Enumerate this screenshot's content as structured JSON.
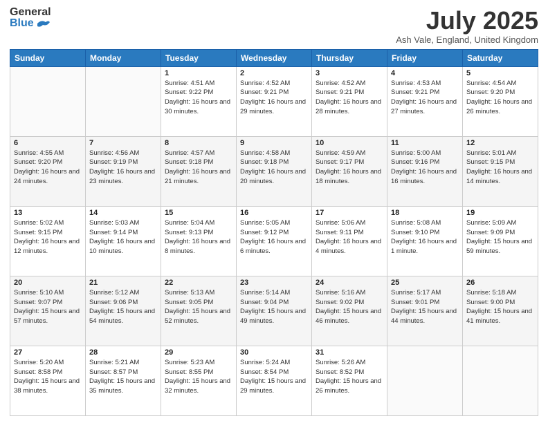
{
  "header": {
    "logo_general": "General",
    "logo_blue": "Blue",
    "month_year": "July 2025",
    "location": "Ash Vale, England, United Kingdom"
  },
  "weekdays": [
    "Sunday",
    "Monday",
    "Tuesday",
    "Wednesday",
    "Thursday",
    "Friday",
    "Saturday"
  ],
  "weeks": [
    [
      {
        "day": "",
        "info": ""
      },
      {
        "day": "",
        "info": ""
      },
      {
        "day": "1",
        "info": "Sunrise: 4:51 AM\nSunset: 9:22 PM\nDaylight: 16 hours and 30 minutes."
      },
      {
        "day": "2",
        "info": "Sunrise: 4:52 AM\nSunset: 9:21 PM\nDaylight: 16 hours and 29 minutes."
      },
      {
        "day": "3",
        "info": "Sunrise: 4:52 AM\nSunset: 9:21 PM\nDaylight: 16 hours and 28 minutes."
      },
      {
        "day": "4",
        "info": "Sunrise: 4:53 AM\nSunset: 9:21 PM\nDaylight: 16 hours and 27 minutes."
      },
      {
        "day": "5",
        "info": "Sunrise: 4:54 AM\nSunset: 9:20 PM\nDaylight: 16 hours and 26 minutes."
      }
    ],
    [
      {
        "day": "6",
        "info": "Sunrise: 4:55 AM\nSunset: 9:20 PM\nDaylight: 16 hours and 24 minutes."
      },
      {
        "day": "7",
        "info": "Sunrise: 4:56 AM\nSunset: 9:19 PM\nDaylight: 16 hours and 23 minutes."
      },
      {
        "day": "8",
        "info": "Sunrise: 4:57 AM\nSunset: 9:18 PM\nDaylight: 16 hours and 21 minutes."
      },
      {
        "day": "9",
        "info": "Sunrise: 4:58 AM\nSunset: 9:18 PM\nDaylight: 16 hours and 20 minutes."
      },
      {
        "day": "10",
        "info": "Sunrise: 4:59 AM\nSunset: 9:17 PM\nDaylight: 16 hours and 18 minutes."
      },
      {
        "day": "11",
        "info": "Sunrise: 5:00 AM\nSunset: 9:16 PM\nDaylight: 16 hours and 16 minutes."
      },
      {
        "day": "12",
        "info": "Sunrise: 5:01 AM\nSunset: 9:15 PM\nDaylight: 16 hours and 14 minutes."
      }
    ],
    [
      {
        "day": "13",
        "info": "Sunrise: 5:02 AM\nSunset: 9:15 PM\nDaylight: 16 hours and 12 minutes."
      },
      {
        "day": "14",
        "info": "Sunrise: 5:03 AM\nSunset: 9:14 PM\nDaylight: 16 hours and 10 minutes."
      },
      {
        "day": "15",
        "info": "Sunrise: 5:04 AM\nSunset: 9:13 PM\nDaylight: 16 hours and 8 minutes."
      },
      {
        "day": "16",
        "info": "Sunrise: 5:05 AM\nSunset: 9:12 PM\nDaylight: 16 hours and 6 minutes."
      },
      {
        "day": "17",
        "info": "Sunrise: 5:06 AM\nSunset: 9:11 PM\nDaylight: 16 hours and 4 minutes."
      },
      {
        "day": "18",
        "info": "Sunrise: 5:08 AM\nSunset: 9:10 PM\nDaylight: 16 hours and 1 minute."
      },
      {
        "day": "19",
        "info": "Sunrise: 5:09 AM\nSunset: 9:09 PM\nDaylight: 15 hours and 59 minutes."
      }
    ],
    [
      {
        "day": "20",
        "info": "Sunrise: 5:10 AM\nSunset: 9:07 PM\nDaylight: 15 hours and 57 minutes."
      },
      {
        "day": "21",
        "info": "Sunrise: 5:12 AM\nSunset: 9:06 PM\nDaylight: 15 hours and 54 minutes."
      },
      {
        "day": "22",
        "info": "Sunrise: 5:13 AM\nSunset: 9:05 PM\nDaylight: 15 hours and 52 minutes."
      },
      {
        "day": "23",
        "info": "Sunrise: 5:14 AM\nSunset: 9:04 PM\nDaylight: 15 hours and 49 minutes."
      },
      {
        "day": "24",
        "info": "Sunrise: 5:16 AM\nSunset: 9:02 PM\nDaylight: 15 hours and 46 minutes."
      },
      {
        "day": "25",
        "info": "Sunrise: 5:17 AM\nSunset: 9:01 PM\nDaylight: 15 hours and 44 minutes."
      },
      {
        "day": "26",
        "info": "Sunrise: 5:18 AM\nSunset: 9:00 PM\nDaylight: 15 hours and 41 minutes."
      }
    ],
    [
      {
        "day": "27",
        "info": "Sunrise: 5:20 AM\nSunset: 8:58 PM\nDaylight: 15 hours and 38 minutes."
      },
      {
        "day": "28",
        "info": "Sunrise: 5:21 AM\nSunset: 8:57 PM\nDaylight: 15 hours and 35 minutes."
      },
      {
        "day": "29",
        "info": "Sunrise: 5:23 AM\nSunset: 8:55 PM\nDaylight: 15 hours and 32 minutes."
      },
      {
        "day": "30",
        "info": "Sunrise: 5:24 AM\nSunset: 8:54 PM\nDaylight: 15 hours and 29 minutes."
      },
      {
        "day": "31",
        "info": "Sunrise: 5:26 AM\nSunset: 8:52 PM\nDaylight: 15 hours and 26 minutes."
      },
      {
        "day": "",
        "info": ""
      },
      {
        "day": "",
        "info": ""
      }
    ]
  ]
}
